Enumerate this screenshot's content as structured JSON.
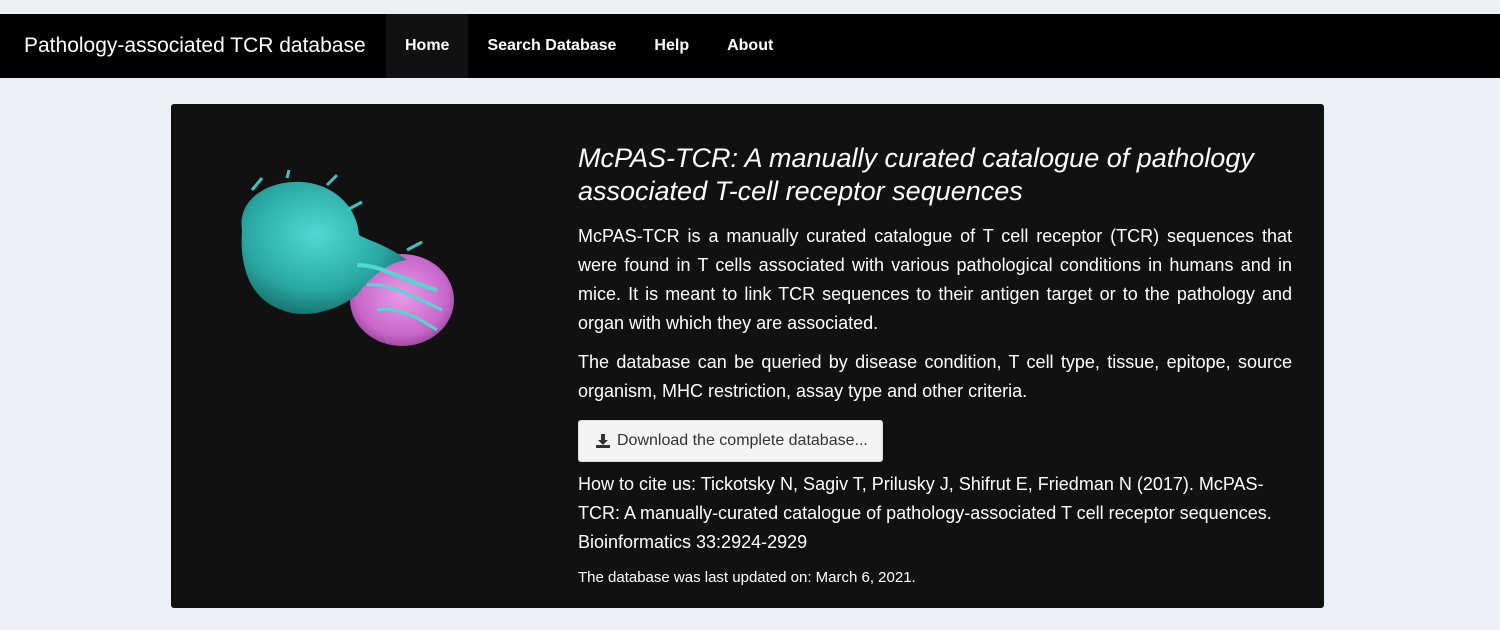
{
  "navbar": {
    "brand": "Pathology-associated TCR database",
    "items": [
      {
        "label": "Home",
        "active": true
      },
      {
        "label": "Search Database",
        "active": false
      },
      {
        "label": "Help",
        "active": false
      },
      {
        "label": "About",
        "active": false
      }
    ]
  },
  "hero": {
    "title": "McPAS-TCR: A manually curated catalogue of pathology associated T-cell receptor sequences",
    "para1": "McPAS-TCR is a manually curated catalogue of T cell receptor (TCR) sequences that were found in T cells associated with various pathological conditions in humans and in mice. It is meant to link TCR sequences to their antigen target or to the pathology and organ with which they are associated.",
    "para2": "The database can be queried by disease condition, T cell type, tissue, epitope, source organism, MHC restriction, assay type and other criteria.",
    "download_label": "Download the complete database...",
    "download_icon": "download-icon",
    "citation": "How to cite us: Tickotsky N, Sagiv T, Prilusky J, Shifrut E, Friedman N (2017). McPAS-TCR: A manually-curated catalogue of pathology-associated T cell receptor sequences. Bioinformatics 33:2924-2929",
    "updated": "The database was last updated on: March 6, 2021."
  },
  "colors": {
    "navbar_bg": "#000000",
    "card_bg": "#111111",
    "page_bg": "#ecf0f5",
    "tcell": "#3cc5c0",
    "target_cell": "#d27fd6"
  }
}
